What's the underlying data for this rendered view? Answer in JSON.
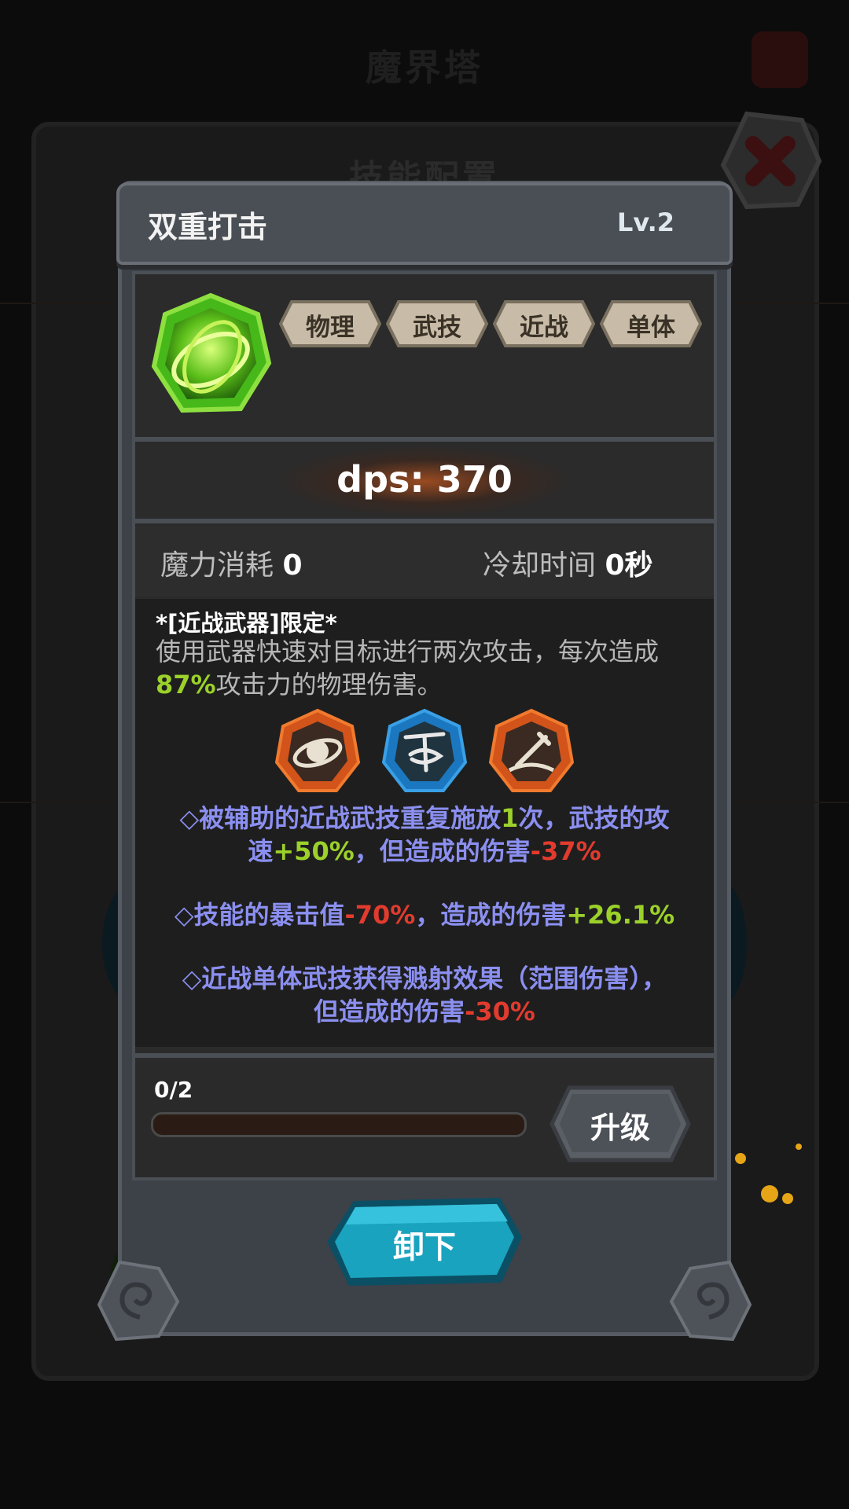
{
  "background": {
    "title": "魔界塔",
    "panel_title": "技能配置"
  },
  "dialog": {
    "skill_name": "双重打击",
    "skill_level": "Lv.2",
    "skill_icon": "green-swirl-icon",
    "tags": [
      "物理",
      "武技",
      "近战",
      "单体"
    ],
    "dps": "dps: 370",
    "mana_label": "魔力消耗",
    "mana_value": "0",
    "cooldown_label": "冷却时间",
    "cooldown_value": "0秒",
    "restriction": "*[近战武器]限定*",
    "description_1": "使用武器快速对目标进行两次攻击，每次造成",
    "description_pct": "87%",
    "description_2": "攻击力的物理伤害。",
    "support_runes": [
      {
        "icon": "ring-orbit-icon",
        "color": "orange"
      },
      {
        "icon": "whirlwind-icon",
        "color": "blue"
      },
      {
        "icon": "sword-splash-icon",
        "color": "orange"
      }
    ],
    "effects": [
      {
        "p1": "◇被辅助的近战武技重复施放",
        "v1": "1",
        "p2": "次，武技的攻",
        "p3": "速",
        "v2": "+50%",
        "p4": "，但造成的伤害",
        "v3": "-37%"
      },
      {
        "p1": "◇技能的暴击值",
        "v1": "-70%",
        "p2": "，造成的伤害",
        "v2": "+26.1%"
      },
      {
        "p1": "◇近战单体武技获得溅射效果（范围伤害），",
        "p2": "但造成的伤害",
        "v1": "-30%"
      }
    ],
    "progress_text": "0/2",
    "progress_value": 0,
    "upgrade_label": "升级",
    "unequip_label": "卸下"
  },
  "colors": {
    "green": "#9bd12a",
    "red": "#e23b2e",
    "effect_text": "#8b8ff0",
    "button_teal": "#1aa3bf"
  }
}
